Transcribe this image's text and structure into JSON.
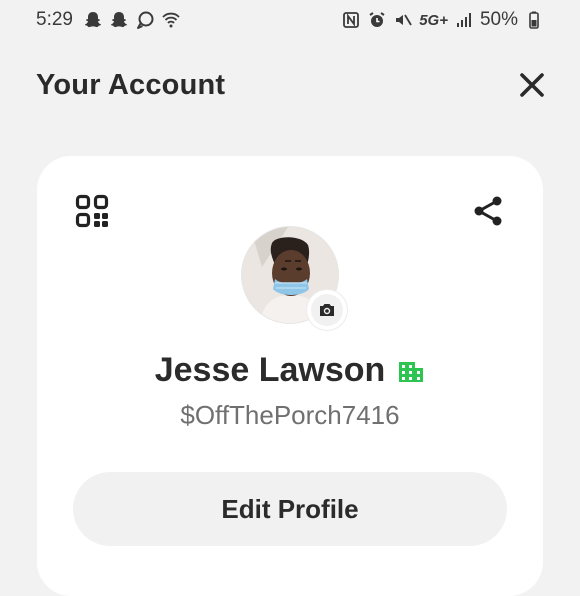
{
  "status_bar": {
    "time": "5:29",
    "network": "5G+",
    "battery": "50%",
    "left_icons": [
      "snapchat-icon",
      "snapchat-icon",
      "messenger-icon",
      "wifi-icon"
    ],
    "right_icons": [
      "nfc-icon",
      "alarm-icon",
      "mute-icon",
      "network-5g-icon",
      "signal-icon",
      "battery-icon"
    ]
  },
  "header": {
    "title": "Your Account",
    "close_icon": "close-icon"
  },
  "profile": {
    "display_name": "Jesse Lawson",
    "cashtag": "$OffThePorch7416",
    "business_badge_color": "#2ec451",
    "edit_label": "Edit Profile"
  },
  "colors": {
    "background": "#f2f2f2",
    "card": "#ffffff",
    "button": "#f1f1f1",
    "accent_green": "#2ec451"
  }
}
